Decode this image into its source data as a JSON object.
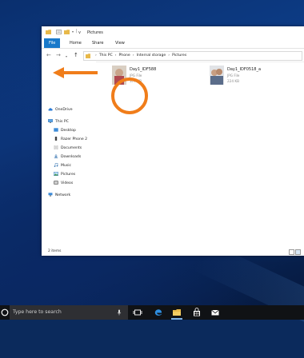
{
  "window": {
    "title": "Pictures",
    "title_prefix": "v",
    "ribbon_tabs": [
      "File",
      "Home",
      "Share",
      "View"
    ],
    "breadcrumb": [
      "This PC",
      "Phone",
      "Internal storage",
      "Pictures"
    ],
    "status": "2 items"
  },
  "nav": {
    "items": [
      {
        "label": "OneDrive"
      },
      {
        "label": "This PC"
      },
      {
        "label": "Desktop"
      },
      {
        "label": "Razer Phone 2"
      },
      {
        "label": "Documents"
      },
      {
        "label": "Downloads"
      },
      {
        "label": "Music"
      },
      {
        "label": "Pictures"
      },
      {
        "label": "Videos"
      },
      {
        "label": "Network"
      }
    ]
  },
  "files": [
    {
      "name": "Day1_IDF588",
      "type": "JPG File",
      "size": "377 KB"
    },
    {
      "name": "Day1_IDF0518_a",
      "type": "JPG File",
      "size": "224 KB"
    }
  ],
  "annotation": {
    "color": "#f07d1a"
  },
  "taskbar": {
    "search_placeholder": "Type here to search"
  },
  "colors": {
    "accent": "#1979ca",
    "annotation": "#f07d1a"
  }
}
